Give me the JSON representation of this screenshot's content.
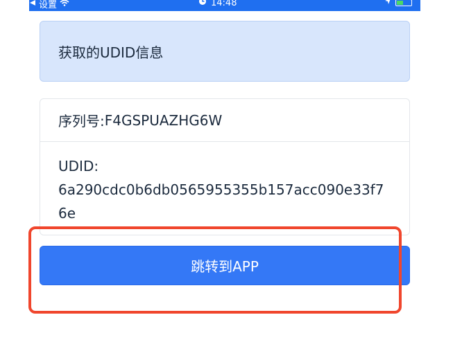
{
  "status_bar": {
    "carrier": "设置",
    "time": "14:48",
    "icons": {
      "back": "back-arrow-icon",
      "wifi": "wifi-icon",
      "alarm": "alarm-icon",
      "location": "location-icon",
      "battery": "battery-icon"
    },
    "colors": {
      "bar": "#1f6ff0",
      "battery_fill": "#4cd964"
    }
  },
  "header": {
    "title": "获取的UDID信息"
  },
  "details": {
    "serial_label": "序列号: ",
    "serial_value": "F4GSPUAZHG6W",
    "udid_label": "UDID:",
    "udid_value": "6a290cdc0b6db0565955355b157acc090e33f76e"
  },
  "actions": {
    "jump_label": "跳转到APP"
  },
  "colors": {
    "header_bg": "#d8e6fc",
    "button_bg": "#3478f6",
    "highlight": "#f0462d"
  }
}
